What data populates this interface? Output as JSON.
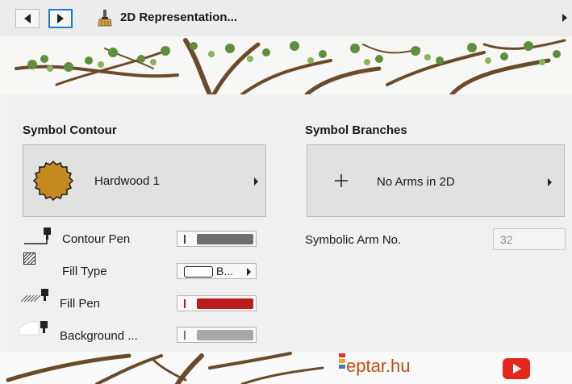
{
  "header": {
    "title": "2D Representation...",
    "back_icon": "triangle-left-icon",
    "forward_icon": "triangle-right-icon",
    "panel_icon": "brush-icon"
  },
  "symbol_contour": {
    "title": "Symbol Contour",
    "selected": "Hardwood 1",
    "rows": [
      {
        "label": "Contour Pen",
        "icon": "contour-pen-icon",
        "swatch_color": "#6e6e6e"
      },
      {
        "label": "Fill Type",
        "icon": "fill-hatch-icon",
        "value": "B..."
      },
      {
        "label": "Fill Pen",
        "icon": "fill-pen-icon",
        "swatch_color": "#b81c1c"
      },
      {
        "label": "Background ...",
        "icon": "background-pen-icon",
        "swatch_color": "#a8a8a8"
      }
    ]
  },
  "symbol_branches": {
    "title": "Symbol Branches",
    "selected": "No Arms in 2D",
    "arm_label": "Symbolic Arm No.",
    "arm_value": "32"
  },
  "watermark": {
    "brand": "eptar.hu"
  },
  "colors": {
    "accent": "#1f78d1",
    "tree_fill": "#c48a1f",
    "youtube": "#e4271d"
  }
}
